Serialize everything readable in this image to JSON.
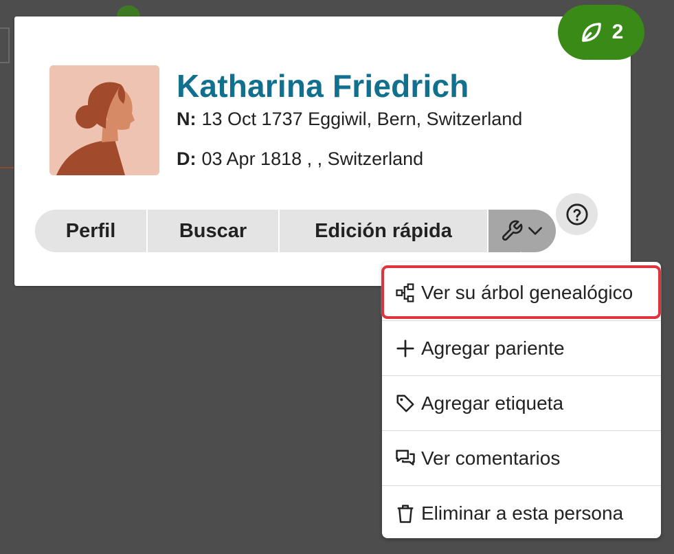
{
  "hints": {
    "count": "2",
    "icon": "leaf-icon",
    "color": "#3a8a17"
  },
  "person": {
    "name": "Katharina Friedrich",
    "birth_label": "N:",
    "birth_value": "13 Oct 1737 Eggiwil, Bern, Switzerland",
    "death_label": "D:",
    "death_value": "03 Apr 1818 , , Switzerland",
    "name_color": "#12708f",
    "avatar": "female-silhouette-avatar"
  },
  "actions": {
    "profile": "Perfil",
    "search": "Buscar",
    "quick_edit": "Edición rápida",
    "tools_icon": "wrench-icon",
    "help_icon": "question-circle-icon"
  },
  "tools_menu": {
    "items": [
      {
        "label": "Ver su árbol genealógico",
        "icon": "tree-icon",
        "highlighted": true
      },
      {
        "label": "Agregar pariente",
        "icon": "plus-icon"
      },
      {
        "label": "Agregar etiqueta",
        "icon": "tag-icon"
      },
      {
        "label": "Ver comentarios",
        "icon": "comments-icon"
      },
      {
        "label": "Eliminar a esta persona",
        "icon": "trash-icon"
      }
    ],
    "highlight_color": "#e0343d"
  }
}
